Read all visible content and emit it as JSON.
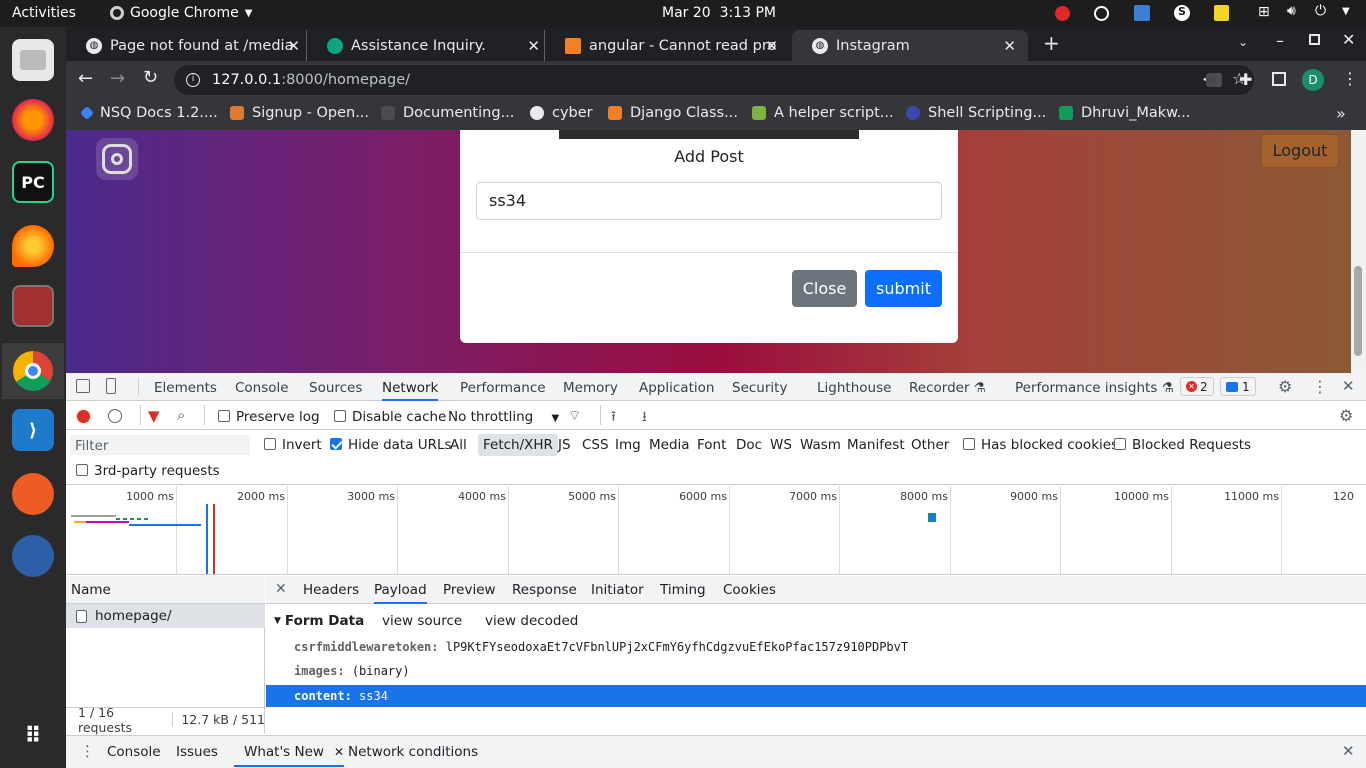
{
  "system": {
    "activities": "Activities",
    "app_name": "Google Chrome",
    "date": "Mar 20",
    "time": "3:13 PM"
  },
  "dock": [
    "Files",
    "Firefox",
    "PyCharm",
    "Sublime",
    "Terminal",
    "Chrome",
    "VS Code",
    "Postman",
    "Tracker",
    "Show Applications"
  ],
  "tabs": [
    {
      "title": "Page not found at /media",
      "close": "✕"
    },
    {
      "title": "Assistance Inquiry.",
      "close": "✕"
    },
    {
      "title": "angular - Cannot read pro",
      "close": "✕"
    },
    {
      "title": "Instagram",
      "close": "✕"
    }
  ],
  "new_tab": "+",
  "url": {
    "host": "127.0.0.1",
    "rest": ":8000/homepage/"
  },
  "profile_initial": "D",
  "bookmarks": [
    "NSQ Docs 1.2....",
    "Signup - Open...",
    "Documenting...",
    "cyber",
    "Django Class...",
    "A helper script...",
    "Shell Scripting...",
    "Dhruvi_Makw..."
  ],
  "bookmarks_more": "»",
  "page": {
    "logout": "Logout"
  },
  "modal": {
    "title": "Add Post",
    "input_value": "ss34",
    "close_label": "Close",
    "submit_label": "submit"
  },
  "devtools": {
    "tabs": [
      "Elements",
      "Console",
      "Sources",
      "Network",
      "Performance",
      "Memory",
      "Application",
      "Security",
      "Lighthouse",
      "Recorder",
      "Performance insights"
    ],
    "errors": "2",
    "messages": "1",
    "preserve_log": "Preserve log",
    "disable_cache": "Disable cache",
    "throttling": "No throttling",
    "filter_placeholder": "Filter",
    "invert": "Invert",
    "hide_data_urls": "Hide data URLs",
    "types": [
      "All",
      "Fetch/XHR",
      "JS",
      "CSS",
      "Img",
      "Media",
      "Font",
      "Doc",
      "WS",
      "Wasm",
      "Manifest",
      "Other"
    ],
    "has_blocked_cookies": "Has blocked cookies",
    "blocked_requests": "Blocked Requests",
    "third_party": "3rd-party requests",
    "ticks": [
      "1000 ms",
      "2000 ms",
      "3000 ms",
      "4000 ms",
      "5000 ms",
      "6000 ms",
      "7000 ms",
      "8000 ms",
      "9000 ms",
      "10000 ms",
      "11000 ms",
      "120"
    ],
    "name_header": "Name",
    "request_name": "homepage/",
    "panel_tabs": [
      "Headers",
      "Payload",
      "Preview",
      "Response",
      "Initiator",
      "Timing",
      "Cookies"
    ],
    "form_data": "Form Data",
    "view_source": "view source",
    "view_decoded": "view decoded",
    "fields": [
      {
        "key": "csrfmiddlewaretoken:",
        "value": "lP9KtFYseodoxaEt7cVFbnlUPj2xCFmY6yfhCdgzvuEfEkoPfac157z910PDPbvT"
      },
      {
        "key": "images:",
        "value": "(binary)"
      },
      {
        "key": "content:",
        "value": "ss34"
      }
    ],
    "status_requests": "1 / 16 requests",
    "status_size": "12.7 kB / 511",
    "drawer_tabs": [
      "Console",
      "Issues",
      "What's New",
      "Network conditions"
    ]
  }
}
